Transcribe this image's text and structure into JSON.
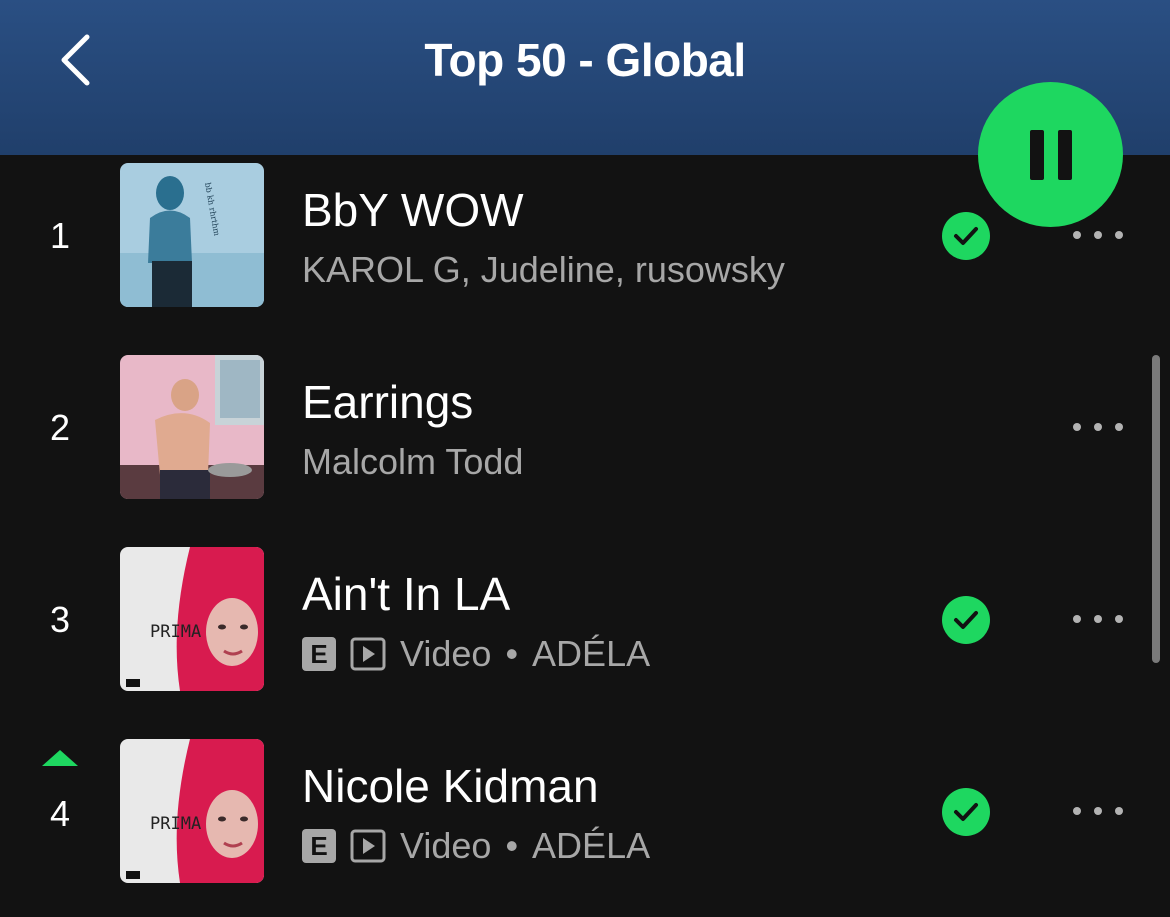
{
  "header": {
    "title": "Top 50 - Global",
    "back_icon": "chevron-left-icon",
    "background": "#244a7c"
  },
  "player": {
    "state_icon": "pause-icon",
    "accent": "#1ed760"
  },
  "tracks": [
    {
      "rank": "1",
      "title": "BbY WOW",
      "artists": "KAROL G, Judeline, rusowsky",
      "explicit": false,
      "video": false,
      "saved": true,
      "trend": null
    },
    {
      "rank": "2",
      "title": "Earrings",
      "artists": "Malcolm Todd",
      "explicit": false,
      "video": false,
      "saved": false,
      "trend": null
    },
    {
      "rank": "3",
      "title": "Ain't In LA",
      "explicit_badge": "E",
      "video_label": "Video",
      "separator": "•",
      "artists": "ADÉLA",
      "explicit": true,
      "video": true,
      "saved": true,
      "trend": null
    },
    {
      "rank": "4",
      "title": "Nicole Kidman",
      "explicit_badge": "E",
      "video_label": "Video",
      "separator": "•",
      "artists": "ADÉLA",
      "explicit": true,
      "video": true,
      "saved": true,
      "trend": "up"
    }
  ],
  "cover_text": {
    "prima": "PRIMA"
  },
  "colors": {
    "background": "#121212",
    "secondary_text": "#a7a7a7",
    "green": "#1ed760"
  }
}
